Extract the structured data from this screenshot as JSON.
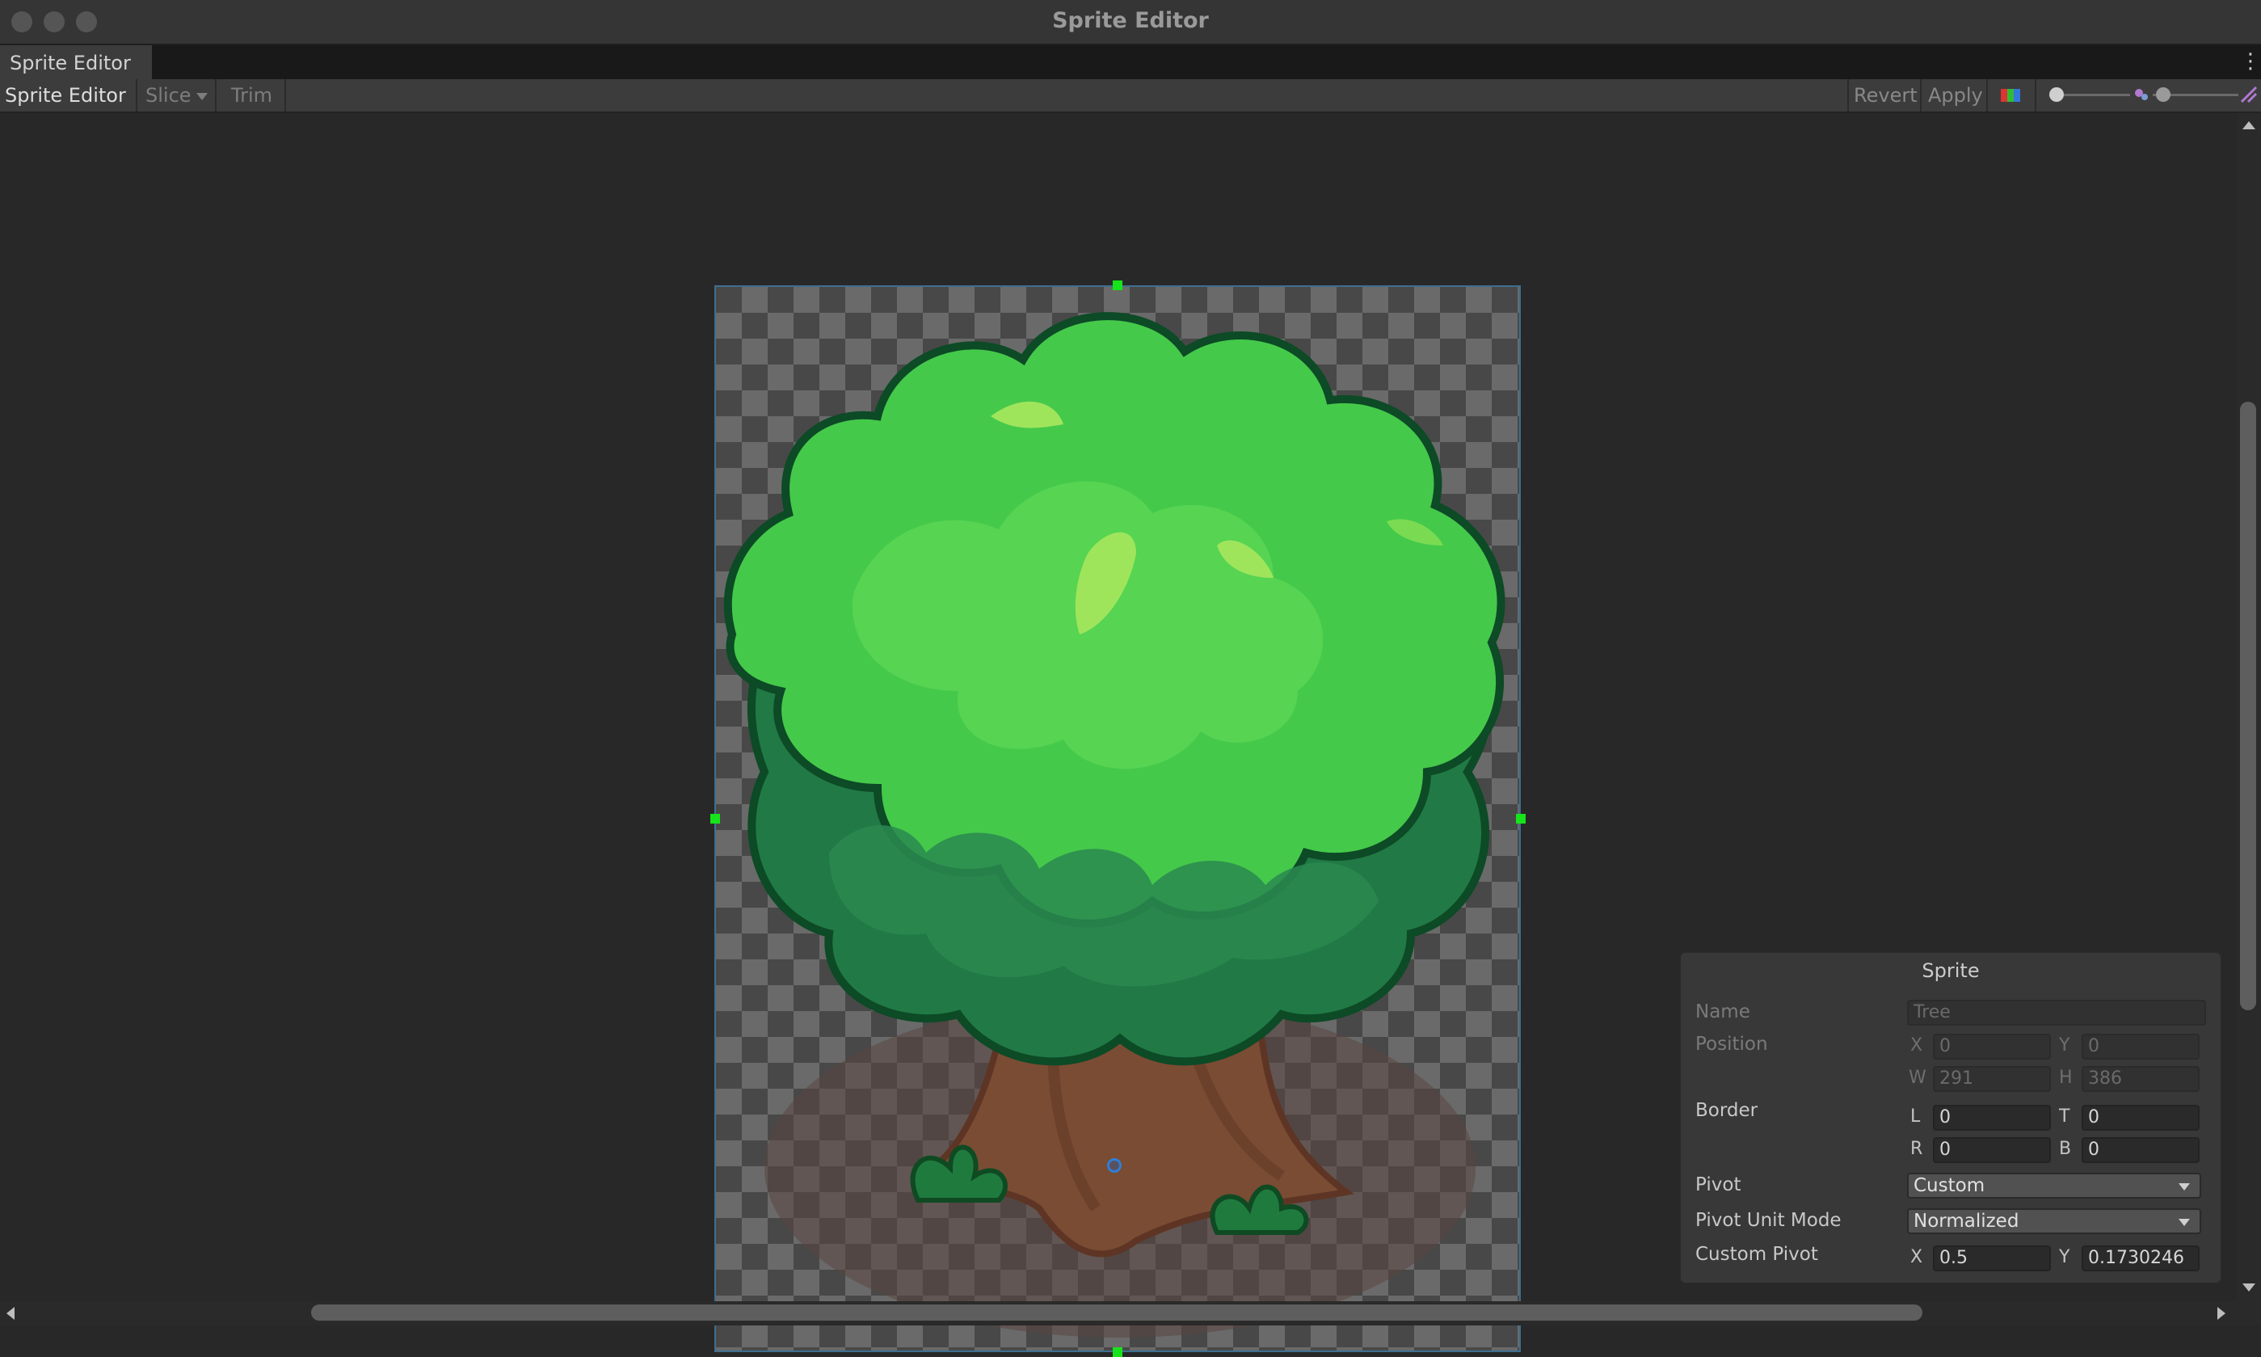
{
  "window": {
    "title": "Sprite Editor"
  },
  "tab": {
    "label": "Sprite Editor"
  },
  "toolbar": {
    "mode": "Sprite Editor",
    "slice": "Slice",
    "trim": "Trim",
    "revert": "Revert",
    "apply": "Apply"
  },
  "panel": {
    "title": "Sprite",
    "name_label": "Name",
    "name_value": "Tree",
    "position_label": "Position",
    "pos_x": "0",
    "pos_y": "0",
    "pos_w": "291",
    "pos_h": "386",
    "border_label": "Border",
    "border_l": "0",
    "border_t": "0",
    "border_r": "0",
    "border_b": "0",
    "pivot_label": "Pivot",
    "pivot_value": "Custom",
    "pivot_unit_label": "Pivot Unit Mode",
    "pivot_unit_value": "Normalized",
    "custom_pivot_label": "Custom Pivot",
    "custom_pivot_x": "0.5",
    "custom_pivot_y": "0.1730246",
    "axis_x": "X",
    "axis_y": "Y",
    "axis_w": "W",
    "axis_h": "H",
    "axis_l": "L",
    "axis_t": "T",
    "axis_r": "R",
    "axis_b": "B"
  },
  "icons": {
    "color_channel": "rgb-channel-icon",
    "menu": "kebab-menu-icon"
  }
}
